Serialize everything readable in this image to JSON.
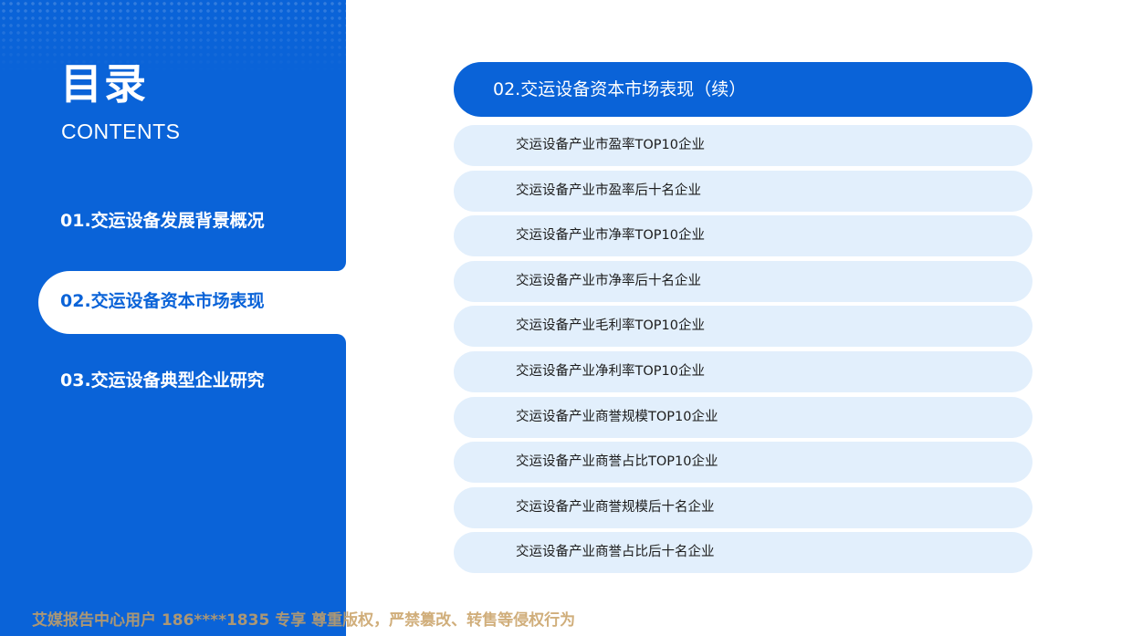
{
  "sidebar": {
    "title": "目录",
    "subtitle": "CONTENTS",
    "items": [
      {
        "label": "01.交运设备发展背景概况"
      },
      {
        "label": "02.交运设备资本市场表现"
      },
      {
        "label": "03.交运设备典型企业研究"
      }
    ],
    "active_index": 1
  },
  "main": {
    "header": "02.交运设备资本市场表现（续）",
    "items": [
      "交运设备产业市盈率TOP10企业",
      "交运设备产业市盈率后十名企业",
      "交运设备产业市净率TOP10企业",
      "交运设备产业市净率后十名企业",
      "交运设备产业毛利率TOP10企业",
      "交运设备产业净利率TOP10企业",
      "交运设备产业商誉规模TOP10企业",
      "交运设备产业商誉占比TOP10企业",
      "交运设备产业商誉规模后十名企业",
      "交运设备产业商誉占比后十名企业"
    ]
  },
  "watermark": "艾媒报告中心用户 186****1835 专享 尊重版权，严禁篡改、转售等侵权行为",
  "colors": {
    "primary": "#0a63d8",
    "item_bg": "#e2effc",
    "text": "#1c1c1c"
  }
}
